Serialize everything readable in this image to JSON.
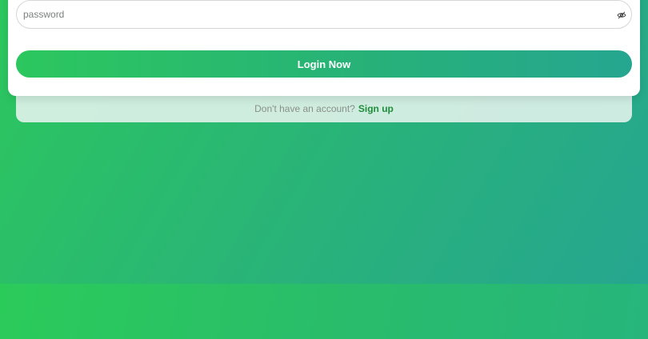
{
  "login_form": {
    "password_placeholder": "password",
    "password_value": "",
    "toggle_visibility_icon": "eye-slash-icon",
    "submit_label": "Login Now"
  },
  "signup": {
    "prompt": "Don't have an account?",
    "link_label": "Sign up"
  },
  "colors": {
    "accent_green": "#2cc75e",
    "accent_teal": "#25a690",
    "link_green": "#1f8d3a"
  }
}
